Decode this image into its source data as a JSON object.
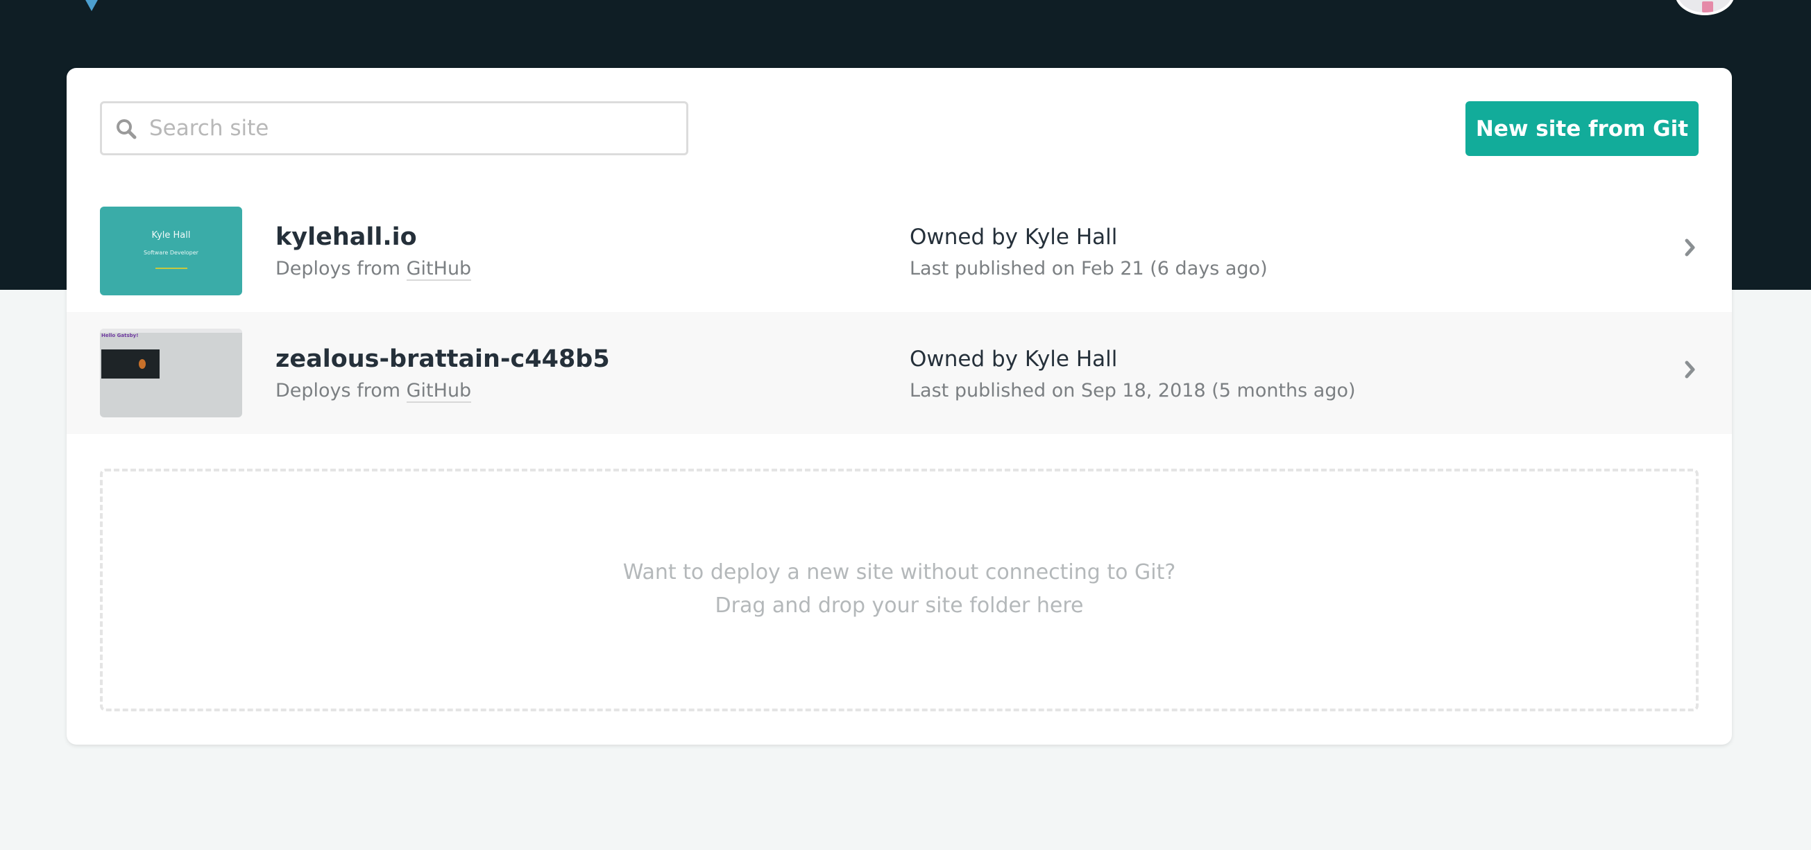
{
  "header": {
    "logo_icon": "netlify-logo-icon",
    "avatar_icon": "user-avatar-icon",
    "background_color": "#0f1e25"
  },
  "toolbar": {
    "search_placeholder": "Search site",
    "search_value": "",
    "new_site_label": "New site from Git",
    "accent_color": "#12ac9a"
  },
  "sites": [
    {
      "name": "kylehall.io",
      "deploys_prefix": "Deploys from",
      "provider": "GitHub",
      "owned_prefix": "Owned by",
      "owner": "Kyle Hall",
      "last_published": "Last published on Feb 21 (6 days ago)",
      "thumbnail": {
        "title": "Kyle Hall",
        "subtitle": "Software Developer"
      }
    },
    {
      "name": "zealous-brattain-c448b5",
      "deploys_prefix": "Deploys from",
      "provider": "GitHub",
      "owned_prefix": "Owned by",
      "owner": "Kyle Hall",
      "last_published": "Last published on Sep 18, 2018 (5 months ago)",
      "thumbnail": {
        "title": "Hello Gatsby!"
      }
    }
  ],
  "dropzone": {
    "line1": "Want to deploy a new site without connecting to Git?",
    "line2": "Drag and drop your site folder here"
  }
}
